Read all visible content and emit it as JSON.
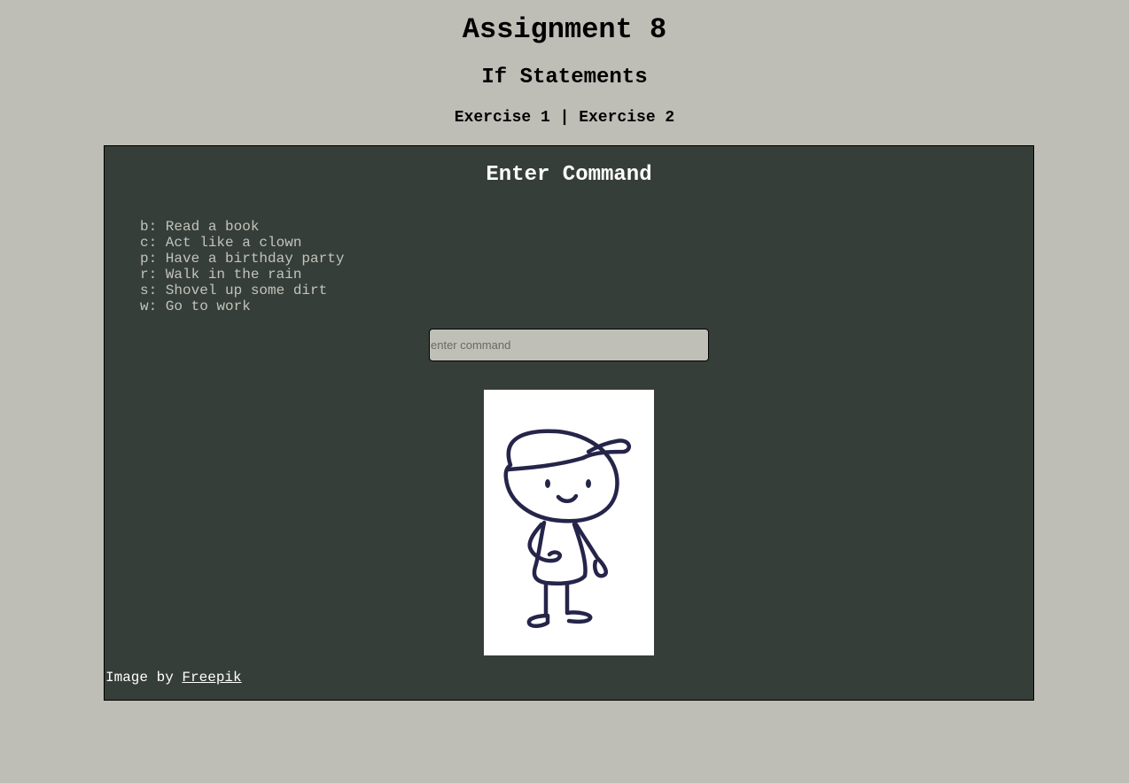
{
  "page": {
    "title": "Assignment 8",
    "subtitle": "If Statements"
  },
  "nav": {
    "exercise1": "Exercise 1",
    "separator": " | ",
    "exercise2": "Exercise 2"
  },
  "panel": {
    "title": "Enter Command",
    "commands": [
      "b: Read a book",
      "c: Act like a clown",
      "p: Have a birthday party",
      "r: Walk in the rain",
      "s: Shovel up some dirt",
      "w: Go to work"
    ],
    "input": {
      "placeholder": "enter command",
      "value": ""
    },
    "illustration": {
      "icon": "cartoon-boy-with-cap"
    },
    "credit": {
      "prefix": "Image by ",
      "link": "Freepik"
    }
  },
  "colors": {
    "background": "#bebeb6",
    "panel": "#363e39",
    "command_text": "#c3c3bb",
    "drawing_stroke": "#25254a"
  }
}
